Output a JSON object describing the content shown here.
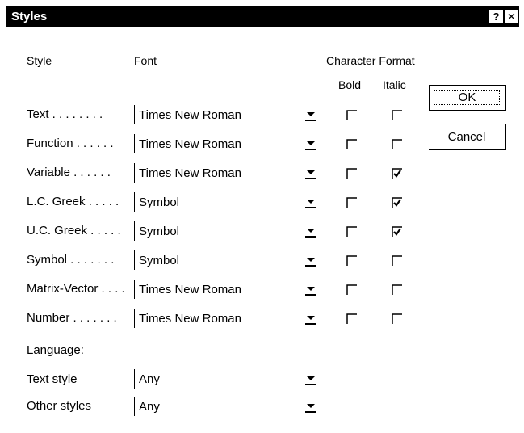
{
  "window": {
    "title": "Styles",
    "help_label": "?",
    "close_label": "✕"
  },
  "headers": {
    "style": "Style",
    "font": "Font",
    "character_format": "Character Format",
    "bold": "Bold",
    "italic": "Italic"
  },
  "rows": [
    {
      "label": "Text . . . . . . . .",
      "font": "Times New Roman",
      "bold": false,
      "italic": false
    },
    {
      "label": "Function . . . . . .",
      "font": "Times New Roman",
      "bold": false,
      "italic": false
    },
    {
      "label": "Variable . . . . . .",
      "font": "Times New Roman",
      "bold": false,
      "italic": true
    },
    {
      "label": "L.C. Greek . . . . .",
      "font": "Symbol",
      "bold": false,
      "italic": true
    },
    {
      "label": "U.C. Greek . . . . .",
      "font": "Symbol",
      "bold": false,
      "italic": true
    },
    {
      "label": "Symbol . . . . . . .",
      "font": "Symbol",
      "bold": false,
      "italic": false
    },
    {
      "label": "Matrix-Vector . . . .",
      "font": "Times New Roman",
      "bold": false,
      "italic": false
    },
    {
      "label": "Number . . . . . . .",
      "font": "Times New Roman",
      "bold": false,
      "italic": false
    }
  ],
  "language": {
    "heading": "Language:",
    "text_style_label": "Text style",
    "text_style_value": "Any",
    "other_styles_label": "Other styles",
    "other_styles_value": "Any"
  },
  "buttons": {
    "ok": "OK",
    "cancel": "Cancel"
  }
}
